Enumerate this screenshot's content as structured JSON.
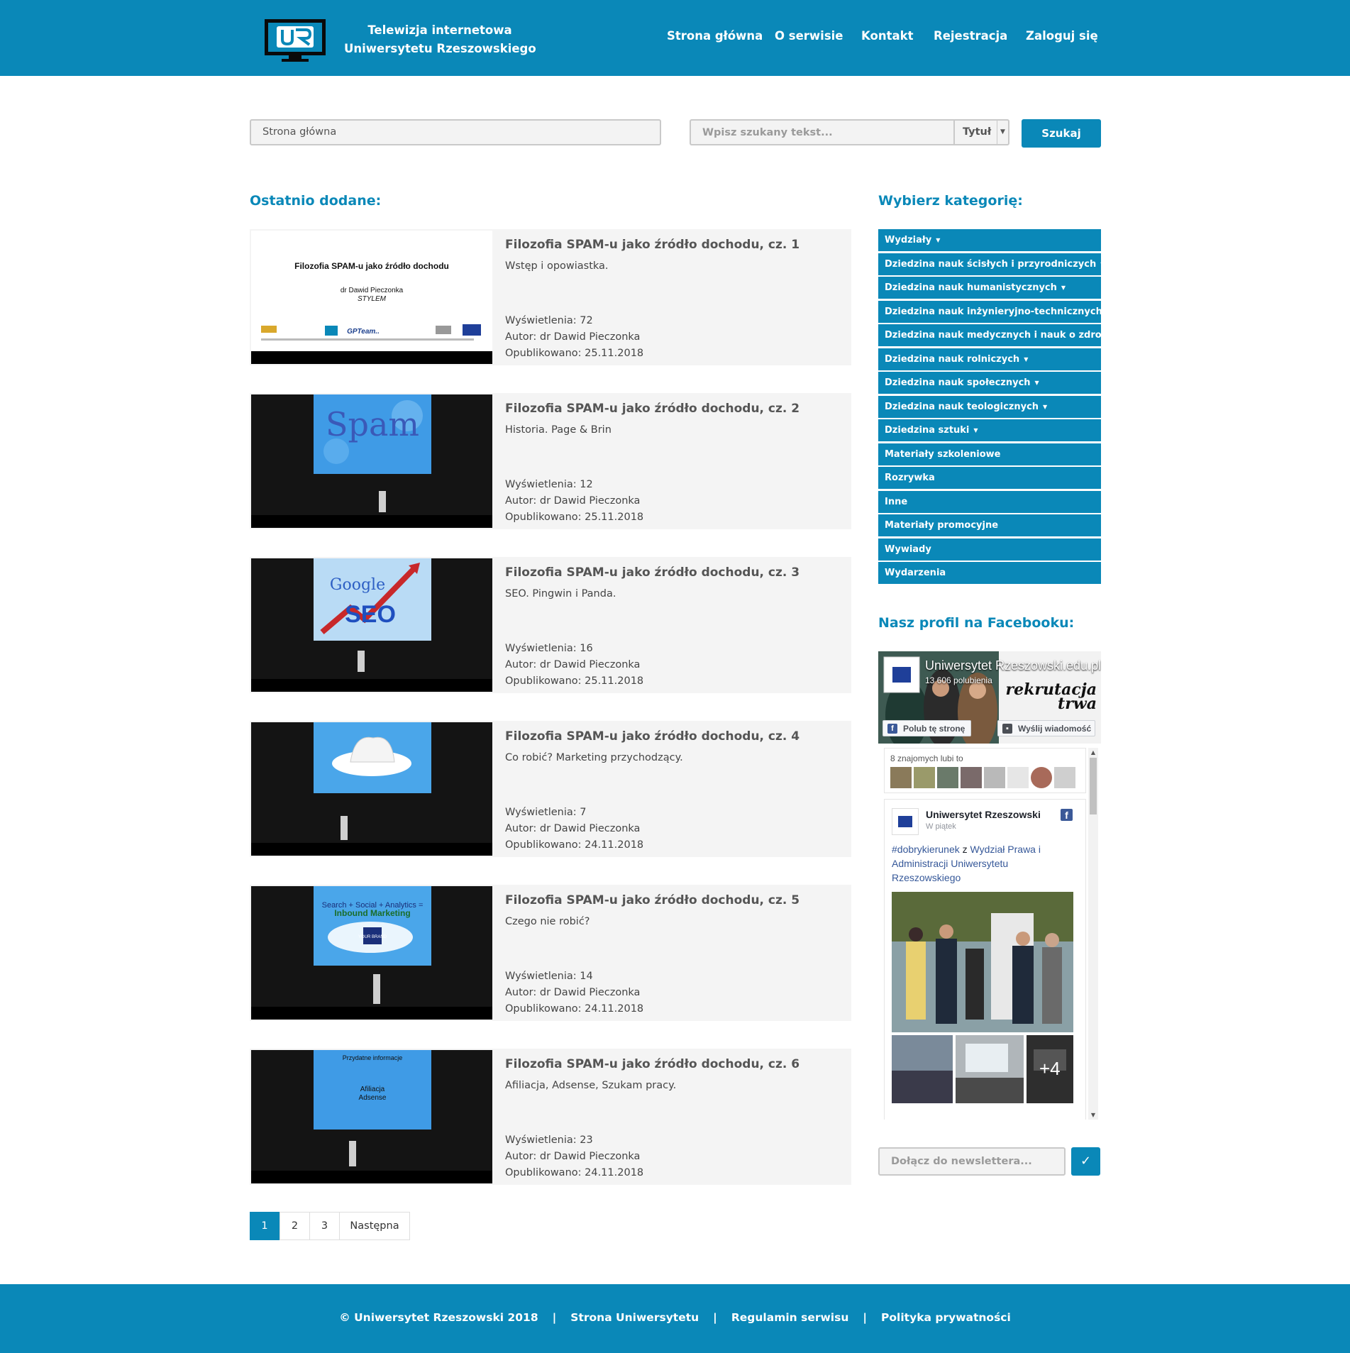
{
  "header": {
    "title_line1": "Telewizja internetowa",
    "title_line2": "Uniwersytetu Rzeszowskiego",
    "nav": [
      "Strona główna",
      "O serwisie",
      "Kontakt",
      "Rejestracja",
      "Zaloguj się"
    ]
  },
  "search": {
    "breadcrumb": "Strona główna",
    "placeholder": "Wpisz szukany tekst...",
    "select_value": "Tytuł",
    "button": "Szukaj"
  },
  "recent": {
    "heading": "Ostatnio dodane:",
    "items": [
      {
        "title": "Filozofia SPAM-u jako źródło dochodu, cz. 1",
        "desc": "Wstęp i opowiastka.",
        "views": "Wyświetlenia: 72",
        "author": "Autor: dr Dawid Pieczonka",
        "published": "Opublikowano: 25.11.2018"
      },
      {
        "title": "Filozofia SPAM-u jako źródło dochodu, cz. 2",
        "desc": "Historia. Page & Brin",
        "views": "Wyświetlenia: 12",
        "author": "Autor: dr Dawid Pieczonka",
        "published": "Opublikowano: 25.11.2018"
      },
      {
        "title": "Filozofia SPAM-u jako źródło dochodu, cz. 3",
        "desc": "SEO. Pingwin i Panda.",
        "views": "Wyświetlenia: 16",
        "author": "Autor: dr Dawid Pieczonka",
        "published": "Opublikowano: 25.11.2018"
      },
      {
        "title": "Filozofia SPAM-u jako źródło dochodu, cz. 4",
        "desc": "Co robić? Marketing przychodzący.",
        "views": "Wyświetlenia: 7",
        "author": "Autor: dr Dawid Pieczonka",
        "published": "Opublikowano: 24.11.2018"
      },
      {
        "title": "Filozofia SPAM-u jako źródło dochodu, cz. 5",
        "desc": "Czego nie robić?",
        "views": "Wyświetlenia: 14",
        "author": "Autor: dr Dawid Pieczonka",
        "published": "Opublikowano: 24.11.2018"
      },
      {
        "title": "Filozofia SPAM-u jako źródło dochodu, cz. 6",
        "desc": "Afiliacja, Adsense, Szukam pracy.",
        "views": "Wyświetlenia: 23",
        "author": "Autor: dr Dawid Pieczonka",
        "published": "Opublikowano: 24.11.2018"
      }
    ]
  },
  "thumbs": {
    "slide1_title": "Filozofia SPAM-u jako źródło dochodu",
    "slide1_author": "dr Dawid Pieczonka",
    "slide1_sub": "STYLEM",
    "slide1_logo": "GPTeam..",
    "slide2_word": "Spam",
    "slide3_word1": "Google",
    "slide3_word2": "SEO",
    "slide5_line1": "Search + Social + Analytics =",
    "slide5_line2": "Inbound Marketing",
    "slide5_brand": "YOUR BRAND",
    "slide6_head": "Przydatne informacje",
    "slide6_l1": "Afiliacja",
    "slide6_l2": "Adsense"
  },
  "categories": {
    "heading": "Wybierz kategorię:",
    "items": [
      {
        "label": "Wydziały",
        "arrow": "▼"
      },
      {
        "label": "Dziedzina nauk ścisłych i przyrodniczych",
        "arrow": "▼"
      },
      {
        "label": "Dziedzina nauk humanistycznych",
        "arrow": "▼"
      },
      {
        "label": "Dziedzina nauk inżynieryjno-technicznych",
        "arrow": "▼"
      },
      {
        "label": "Dziedzina nauk medycznych i nauk o zdrowiu",
        "arrow": "▼"
      },
      {
        "label": "Dziedzina nauk rolniczych",
        "arrow": "▼"
      },
      {
        "label": "Dziedzina nauk społecznych",
        "arrow": "▼"
      },
      {
        "label": "Dziedzina nauk teologicznych",
        "arrow": "▼"
      },
      {
        "label": "Dziedzina sztuki",
        "arrow": "▼"
      },
      {
        "label": "Materiały szkoleniowe",
        "arrow": ""
      },
      {
        "label": "Rozrywka",
        "arrow": ""
      },
      {
        "label": "Inne",
        "arrow": ""
      },
      {
        "label": "Materiały promocyjne",
        "arrow": ""
      },
      {
        "label": "Wywiady",
        "arrow": ""
      },
      {
        "label": "Wydarzenia",
        "arrow": ""
      }
    ]
  },
  "facebook": {
    "heading": "Nasz profil na Facebooku:",
    "page_name": "Uniwersytet Rzeszowski",
    "page_name_suffix": ".edu.pl",
    "likes": "13 606 polubienia",
    "promo_line1": "rekrutacja",
    "promo_line2": "trwa",
    "like_button": "Polub tę stronę",
    "message_button": "Wyślij wiadomość",
    "friends_like": "8 znajomych lubi to",
    "post_author": "Uniwersytet Rzeszowski",
    "post_time": "W piątek",
    "post_hashtag": "#dobrykierunek",
    "post_joiner": " z ",
    "post_link": "Wydział Prawa i Administracji Uniwersytetu Rzeszowskiego",
    "more_photos": "+4"
  },
  "newsletter": {
    "placeholder": "Dołącz do newslettera...",
    "button": "✓"
  },
  "pagination": {
    "pages": [
      "1",
      "2",
      "3"
    ],
    "next": "Następna",
    "current": "1"
  },
  "footer": {
    "copyright": "© Uniwersytet Rzeszowski 2018",
    "link1": "Strona Uniwersytetu",
    "link2": "Regulamin serwisu",
    "link3": "Polityka prywatności",
    "separator": "|"
  },
  "colors": {
    "brand": "#0a88b8",
    "card_bg": "#f4f4f4",
    "facebook_blue": "#3b5998"
  }
}
